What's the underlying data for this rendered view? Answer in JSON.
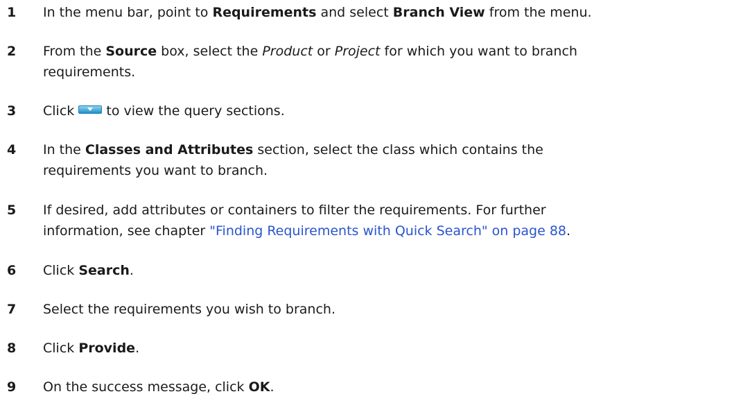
{
  "steps": [
    {
      "number": "1",
      "parts": [
        "In the menu bar, point to ",
        "Requirements",
        " and select ",
        "Branch View",
        " from the menu."
      ]
    },
    {
      "number": "2",
      "line1": [
        "From the ",
        "Source",
        " box, select the ",
        "Product",
        " or ",
        "Project",
        " for which you want to branch"
      ],
      "line2": "requirements."
    },
    {
      "number": "3",
      "before": "Click ",
      "icon": "dropdown-arrow-icon",
      "after": " to view the query sections."
    },
    {
      "number": "4",
      "line1": [
        "In the ",
        "Classes and Attributes",
        " section, select the class which contains the"
      ],
      "line2": "requirements you want to branch."
    },
    {
      "number": "5",
      "line1": "If desired, add attributes or containers to filter the requirements. For further",
      "line2_before": "information, see chapter ",
      "link": "\"Finding Requirements with Quick Search\" on page 88",
      "line2_after": "."
    },
    {
      "number": "6",
      "parts": [
        "Click ",
        "Search",
        "."
      ]
    },
    {
      "number": "7",
      "text": "Select the requirements you wish to branch."
    },
    {
      "number": "8",
      "parts": [
        "Click ",
        "Provide",
        "."
      ]
    },
    {
      "number": "9",
      "parts": [
        "On the success message, click ",
        "OK",
        "."
      ]
    }
  ],
  "colors": {
    "text": "#1a1a1a",
    "link": "#2a54cf",
    "button_top": "#8fd3f0",
    "button_bottom": "#1f93c9"
  }
}
